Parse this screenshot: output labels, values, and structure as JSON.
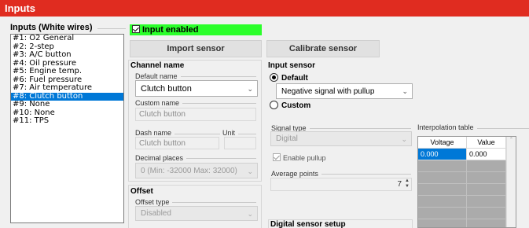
{
  "title": "Inputs",
  "inputs_group": {
    "label": "Inputs (White wires)",
    "items": [
      "#1: O2 General",
      "#2: 2-step",
      "#3: A/C button",
      "#4: Oil pressure",
      "#5: Engine temp.",
      "#6: Fuel pressure",
      "#7: Air temperature",
      "#8: Clutch button",
      "#9: None",
      "#10: None",
      "#11: TPS"
    ],
    "selected_index": 7
  },
  "input_enabled": {
    "label": "Input enabled",
    "checked": true,
    "color": "#2bff2b"
  },
  "buttons": {
    "import": "Import sensor",
    "calibrate": "Calibrate sensor"
  },
  "channel_name": {
    "header": "Channel name",
    "default_name_label": "Default name",
    "default_name_value": "Clutch button",
    "custom_name_label": "Custom name",
    "custom_name_value": "Clutch button",
    "dash_name_label": "Dash name",
    "dash_name_value": "Clutch button",
    "unit_label": "Unit",
    "unit_value": "",
    "decimal_places_label": "Decimal places",
    "decimal_places_value": "0 (Min: -32000  Max: 32000)"
  },
  "offset": {
    "header": "Offset",
    "offset_type_label": "Offset type",
    "offset_type_value": "Disabled"
  },
  "input_sensor": {
    "header": "Input sensor",
    "default_label": "Default",
    "default_selected": true,
    "default_value": "Negative signal with pullup",
    "custom_label": "Custom",
    "signal_type_label": "Signal type",
    "signal_type_value": "Digital",
    "enable_pullup_label": "Enable pullup",
    "enable_pullup_checked": true,
    "average_points_label": "Average points",
    "average_points_value": "7",
    "digital_setup_header": "Digital sensor setup"
  },
  "interpolation": {
    "label": "Interpolation table",
    "columns": [
      "Voltage",
      "Value"
    ],
    "rows": [
      [
        "0.000",
        "0.000"
      ]
    ]
  },
  "colors": {
    "titlebar": "#e02c20",
    "selection": "#0078d7"
  }
}
